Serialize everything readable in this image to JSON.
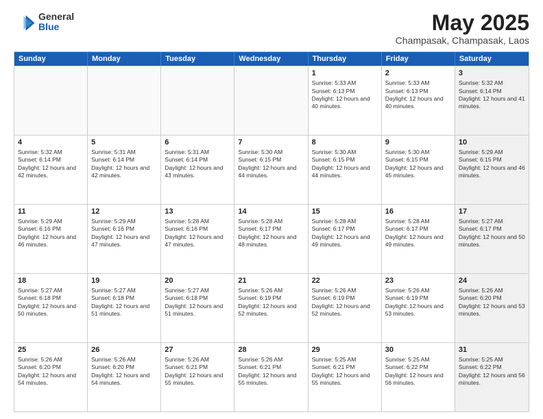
{
  "logo": {
    "general": "General",
    "blue": "Blue"
  },
  "title": "May 2025",
  "subtitle": "Champasak, Champasak, Laos",
  "header_days": [
    "Sunday",
    "Monday",
    "Tuesday",
    "Wednesday",
    "Thursday",
    "Friday",
    "Saturday"
  ],
  "rows": [
    [
      {
        "day": "",
        "empty": true
      },
      {
        "day": "",
        "empty": true
      },
      {
        "day": "",
        "empty": true
      },
      {
        "day": "",
        "empty": true
      },
      {
        "day": "1",
        "sunrise": "Sunrise: 5:33 AM",
        "sunset": "Sunset: 6:13 PM",
        "daylight": "Daylight: 12 hours and 40 minutes."
      },
      {
        "day": "2",
        "sunrise": "Sunrise: 5:33 AM",
        "sunset": "Sunset: 6:13 PM",
        "daylight": "Daylight: 12 hours and 40 minutes."
      },
      {
        "day": "3",
        "sunrise": "Sunrise: 5:32 AM",
        "sunset": "Sunset: 6:14 PM",
        "daylight": "Daylight: 12 hours and 41 minutes.",
        "shaded": true
      }
    ],
    [
      {
        "day": "4",
        "sunrise": "Sunrise: 5:32 AM",
        "sunset": "Sunset: 6:14 PM",
        "daylight": "Daylight: 12 hours and 42 minutes."
      },
      {
        "day": "5",
        "sunrise": "Sunrise: 5:31 AM",
        "sunset": "Sunset: 6:14 PM",
        "daylight": "Daylight: 12 hours and 42 minutes."
      },
      {
        "day": "6",
        "sunrise": "Sunrise: 5:31 AM",
        "sunset": "Sunset: 6:14 PM",
        "daylight": "Daylight: 12 hours and 43 minutes."
      },
      {
        "day": "7",
        "sunrise": "Sunrise: 5:30 AM",
        "sunset": "Sunset: 6:15 PM",
        "daylight": "Daylight: 12 hours and 44 minutes."
      },
      {
        "day": "8",
        "sunrise": "Sunrise: 5:30 AM",
        "sunset": "Sunset: 6:15 PM",
        "daylight": "Daylight: 12 hours and 44 minutes."
      },
      {
        "day": "9",
        "sunrise": "Sunrise: 5:30 AM",
        "sunset": "Sunset: 6:15 PM",
        "daylight": "Daylight: 12 hours and 45 minutes."
      },
      {
        "day": "10",
        "sunrise": "Sunrise: 5:29 AM",
        "sunset": "Sunset: 6:15 PM",
        "daylight": "Daylight: 12 hours and 46 minutes.",
        "shaded": true
      }
    ],
    [
      {
        "day": "11",
        "sunrise": "Sunrise: 5:29 AM",
        "sunset": "Sunset: 6:16 PM",
        "daylight": "Daylight: 12 hours and 46 minutes."
      },
      {
        "day": "12",
        "sunrise": "Sunrise: 5:29 AM",
        "sunset": "Sunset: 6:16 PM",
        "daylight": "Daylight: 12 hours and 47 minutes."
      },
      {
        "day": "13",
        "sunrise": "Sunrise: 5:28 AM",
        "sunset": "Sunset: 6:16 PM",
        "daylight": "Daylight: 12 hours and 47 minutes."
      },
      {
        "day": "14",
        "sunrise": "Sunrise: 5:28 AM",
        "sunset": "Sunset: 6:17 PM",
        "daylight": "Daylight: 12 hours and 48 minutes."
      },
      {
        "day": "15",
        "sunrise": "Sunrise: 5:28 AM",
        "sunset": "Sunset: 6:17 PM",
        "daylight": "Daylight: 12 hours and 49 minutes."
      },
      {
        "day": "16",
        "sunrise": "Sunrise: 5:28 AM",
        "sunset": "Sunset: 6:17 PM",
        "daylight": "Daylight: 12 hours and 49 minutes."
      },
      {
        "day": "17",
        "sunrise": "Sunrise: 5:27 AM",
        "sunset": "Sunset: 6:17 PM",
        "daylight": "Daylight: 12 hours and 50 minutes.",
        "shaded": true
      }
    ],
    [
      {
        "day": "18",
        "sunrise": "Sunrise: 5:27 AM",
        "sunset": "Sunset: 6:18 PM",
        "daylight": "Daylight: 12 hours and 50 minutes."
      },
      {
        "day": "19",
        "sunrise": "Sunrise: 5:27 AM",
        "sunset": "Sunset: 6:18 PM",
        "daylight": "Daylight: 12 hours and 51 minutes."
      },
      {
        "day": "20",
        "sunrise": "Sunrise: 5:27 AM",
        "sunset": "Sunset: 6:18 PM",
        "daylight": "Daylight: 12 hours and 51 minutes."
      },
      {
        "day": "21",
        "sunrise": "Sunrise: 5:26 AM",
        "sunset": "Sunset: 6:19 PM",
        "daylight": "Daylight: 12 hours and 52 minutes."
      },
      {
        "day": "22",
        "sunrise": "Sunrise: 5:26 AM",
        "sunset": "Sunset: 6:19 PM",
        "daylight": "Daylight: 12 hours and 52 minutes."
      },
      {
        "day": "23",
        "sunrise": "Sunrise: 5:26 AM",
        "sunset": "Sunset: 6:19 PM",
        "daylight": "Daylight: 12 hours and 53 minutes."
      },
      {
        "day": "24",
        "sunrise": "Sunrise: 5:26 AM",
        "sunset": "Sunset: 6:20 PM",
        "daylight": "Daylight: 12 hours and 53 minutes.",
        "shaded": true
      }
    ],
    [
      {
        "day": "25",
        "sunrise": "Sunrise: 5:26 AM",
        "sunset": "Sunset: 6:20 PM",
        "daylight": "Daylight: 12 hours and 54 minutes."
      },
      {
        "day": "26",
        "sunrise": "Sunrise: 5:26 AM",
        "sunset": "Sunset: 6:20 PM",
        "daylight": "Daylight: 12 hours and 54 minutes."
      },
      {
        "day": "27",
        "sunrise": "Sunrise: 5:26 AM",
        "sunset": "Sunset: 6:21 PM",
        "daylight": "Daylight: 12 hours and 55 minutes."
      },
      {
        "day": "28",
        "sunrise": "Sunrise: 5:26 AM",
        "sunset": "Sunset: 6:21 PM",
        "daylight": "Daylight: 12 hours and 55 minutes."
      },
      {
        "day": "29",
        "sunrise": "Sunrise: 5:25 AM",
        "sunset": "Sunset: 6:21 PM",
        "daylight": "Daylight: 12 hours and 55 minutes."
      },
      {
        "day": "30",
        "sunrise": "Sunrise: 5:25 AM",
        "sunset": "Sunset: 6:22 PM",
        "daylight": "Daylight: 12 hours and 56 minutes."
      },
      {
        "day": "31",
        "sunrise": "Sunrise: 5:25 AM",
        "sunset": "Sunset: 6:22 PM",
        "daylight": "Daylight: 12 hours and 56 minutes.",
        "shaded": true
      }
    ]
  ]
}
